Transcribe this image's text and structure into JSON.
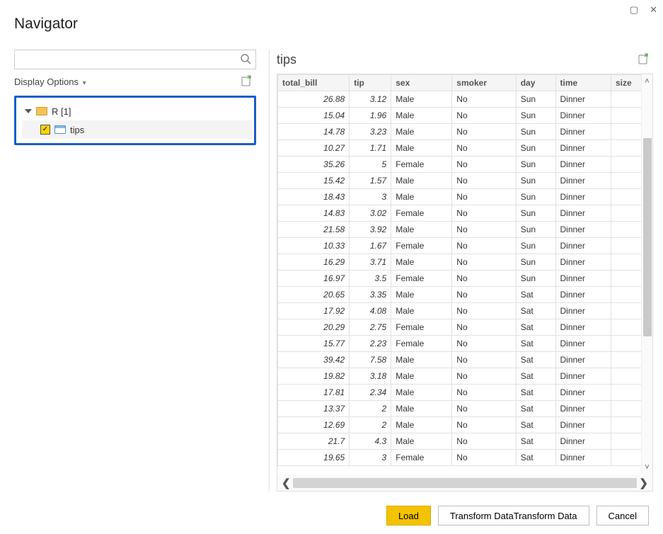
{
  "window": {
    "title": "Navigator"
  },
  "sidebar": {
    "search_placeholder": "",
    "display_options_label": "Display Options",
    "folder_label": "R [1]",
    "table_item_label": "tips"
  },
  "preview": {
    "title": "tips",
    "columns": [
      "total_bill",
      "tip",
      "sex",
      "smoker",
      "day",
      "time",
      "size"
    ],
    "rows": [
      {
        "total_bill": "26.88",
        "tip": "3.12",
        "sex": "Male",
        "smoker": "No",
        "day": "Sun",
        "time": "Dinner",
        "size": ""
      },
      {
        "total_bill": "15.04",
        "tip": "1.96",
        "sex": "Male",
        "smoker": "No",
        "day": "Sun",
        "time": "Dinner",
        "size": ""
      },
      {
        "total_bill": "14.78",
        "tip": "3.23",
        "sex": "Male",
        "smoker": "No",
        "day": "Sun",
        "time": "Dinner",
        "size": ""
      },
      {
        "total_bill": "10.27",
        "tip": "1.71",
        "sex": "Male",
        "smoker": "No",
        "day": "Sun",
        "time": "Dinner",
        "size": ""
      },
      {
        "total_bill": "35.26",
        "tip": "5",
        "sex": "Female",
        "smoker": "No",
        "day": "Sun",
        "time": "Dinner",
        "size": ""
      },
      {
        "total_bill": "15.42",
        "tip": "1.57",
        "sex": "Male",
        "smoker": "No",
        "day": "Sun",
        "time": "Dinner",
        "size": ""
      },
      {
        "total_bill": "18.43",
        "tip": "3",
        "sex": "Male",
        "smoker": "No",
        "day": "Sun",
        "time": "Dinner",
        "size": ""
      },
      {
        "total_bill": "14.83",
        "tip": "3.02",
        "sex": "Female",
        "smoker": "No",
        "day": "Sun",
        "time": "Dinner",
        "size": ""
      },
      {
        "total_bill": "21.58",
        "tip": "3.92",
        "sex": "Male",
        "smoker": "No",
        "day": "Sun",
        "time": "Dinner",
        "size": ""
      },
      {
        "total_bill": "10.33",
        "tip": "1.67",
        "sex": "Female",
        "smoker": "No",
        "day": "Sun",
        "time": "Dinner",
        "size": ""
      },
      {
        "total_bill": "16.29",
        "tip": "3.71",
        "sex": "Male",
        "smoker": "No",
        "day": "Sun",
        "time": "Dinner",
        "size": ""
      },
      {
        "total_bill": "16.97",
        "tip": "3.5",
        "sex": "Female",
        "smoker": "No",
        "day": "Sun",
        "time": "Dinner",
        "size": ""
      },
      {
        "total_bill": "20.65",
        "tip": "3.35",
        "sex": "Male",
        "smoker": "No",
        "day": "Sat",
        "time": "Dinner",
        "size": ""
      },
      {
        "total_bill": "17.92",
        "tip": "4.08",
        "sex": "Male",
        "smoker": "No",
        "day": "Sat",
        "time": "Dinner",
        "size": ""
      },
      {
        "total_bill": "20.29",
        "tip": "2.75",
        "sex": "Female",
        "smoker": "No",
        "day": "Sat",
        "time": "Dinner",
        "size": ""
      },
      {
        "total_bill": "15.77",
        "tip": "2.23",
        "sex": "Female",
        "smoker": "No",
        "day": "Sat",
        "time": "Dinner",
        "size": ""
      },
      {
        "total_bill": "39.42",
        "tip": "7.58",
        "sex": "Male",
        "smoker": "No",
        "day": "Sat",
        "time": "Dinner",
        "size": ""
      },
      {
        "total_bill": "19.82",
        "tip": "3.18",
        "sex": "Male",
        "smoker": "No",
        "day": "Sat",
        "time": "Dinner",
        "size": ""
      },
      {
        "total_bill": "17.81",
        "tip": "2.34",
        "sex": "Male",
        "smoker": "No",
        "day": "Sat",
        "time": "Dinner",
        "size": ""
      },
      {
        "total_bill": "13.37",
        "tip": "2",
        "sex": "Male",
        "smoker": "No",
        "day": "Sat",
        "time": "Dinner",
        "size": ""
      },
      {
        "total_bill": "12.69",
        "tip": "2",
        "sex": "Male",
        "smoker": "No",
        "day": "Sat",
        "time": "Dinner",
        "size": ""
      },
      {
        "total_bill": "21.7",
        "tip": "4.3",
        "sex": "Male",
        "smoker": "No",
        "day": "Sat",
        "time": "Dinner",
        "size": ""
      },
      {
        "total_bill": "19.65",
        "tip": "3",
        "sex": "Female",
        "smoker": "No",
        "day": "Sat",
        "time": "Dinner",
        "size": ""
      }
    ]
  },
  "footer": {
    "load_label": "Load",
    "transform_label": "Transform Data",
    "cancel_label": "Cancel"
  }
}
